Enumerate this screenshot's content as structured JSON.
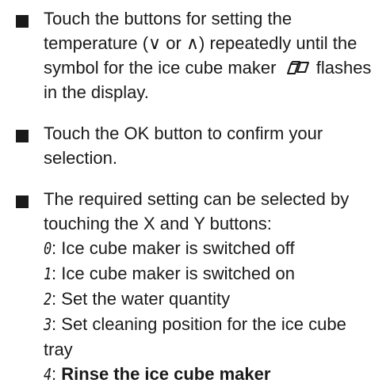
{
  "items": [
    {
      "text_before_icon": "Touch the buttons for setting the temperature (∨ or ∧) repeatedly until the symbol for the ice cube maker",
      "icon": "ice-cube-maker-icon",
      "text_after_icon": "flashes in the display."
    },
    {
      "text": "Touch the OK button to confirm your selection."
    },
    {
      "intro": "The required setting can be selected by touching the X and Y buttons:",
      "options": [
        {
          "code": "0",
          "label": ": Ice cube maker is switched off"
        },
        {
          "code": "1",
          "label": ": Ice cube maker is switched on"
        },
        {
          "code": "2",
          "label": ": Set the water quantity"
        },
        {
          "code": "3",
          "label": ": Set cleaning position for the ice cube tray"
        },
        {
          "code": "4",
          "label": "Rinse the ice cube maker"
        }
      ]
    }
  ]
}
